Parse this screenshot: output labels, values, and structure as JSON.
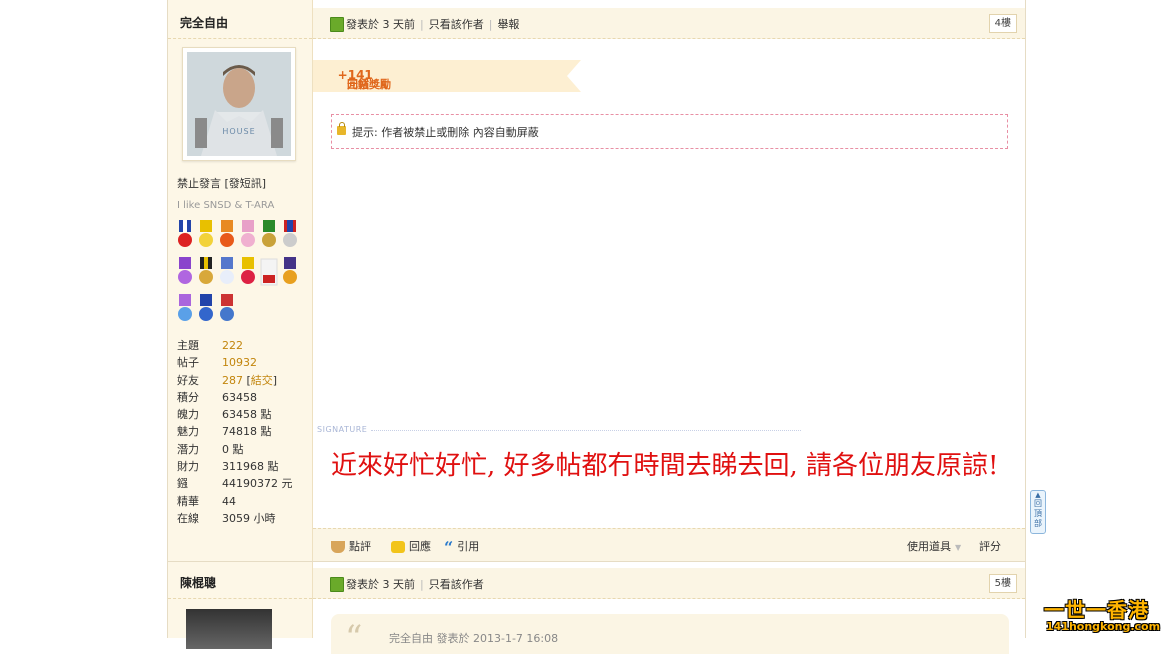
{
  "post1": {
    "author": "完全自由",
    "status": "禁止發言",
    "pm_link": "發短訊",
    "user_signature": "I like SNSD & T-ARA",
    "meta": {
      "posted": "發表於 3 天前",
      "only_author": "只看該作者",
      "report": "舉報"
    },
    "floor": "4樓",
    "reward": {
      "label": "回帖獎勵",
      "amount": "+141",
      "unit": "元鏹"
    },
    "notice": "提示: 作者被禁止或刪除 內容自動屏蔽",
    "signature_label": "SIGNATURE",
    "signature_text": "近來好忙好忙, 好多帖都冇時間去睇去回, 請各位朋友原諒!",
    "stats": [
      {
        "key": "主題",
        "value": "222"
      },
      {
        "key": "帖子",
        "value": "10932"
      },
      {
        "key": "好友",
        "value": "287",
        "extra": "結交"
      },
      {
        "key": "積分",
        "value": "63458"
      },
      {
        "key": "魄力",
        "value": "63458 點"
      },
      {
        "key": "魅力",
        "value": "74818 點"
      },
      {
        "key": "潛力",
        "value": "0 點"
      },
      {
        "key": "財力",
        "value": "311968 點"
      },
      {
        "key": "鏹",
        "value": "44190372 元"
      },
      {
        "key": "精華",
        "value": "44"
      },
      {
        "key": "在線",
        "value": "3059 小時"
      }
    ],
    "actions": {
      "rate": "點評",
      "reply": "回應",
      "quote": "引用",
      "tools": "使用道具",
      "score": "評分"
    }
  },
  "post2": {
    "author": "陳棍聰",
    "meta": {
      "posted": "發表於 3 天前",
      "only_author": "只看該作者"
    },
    "floor": "5樓",
    "quote_header": "完全自由 發表於 2013-1-7 16:08"
  },
  "back_to_top": "回頂部",
  "logo": {
    "cn": "一世一香港",
    "url": "141hongkong.com"
  },
  "colors": {
    "accent": "#c2850c",
    "signature": "#e01010",
    "reward": "#e0671c"
  }
}
